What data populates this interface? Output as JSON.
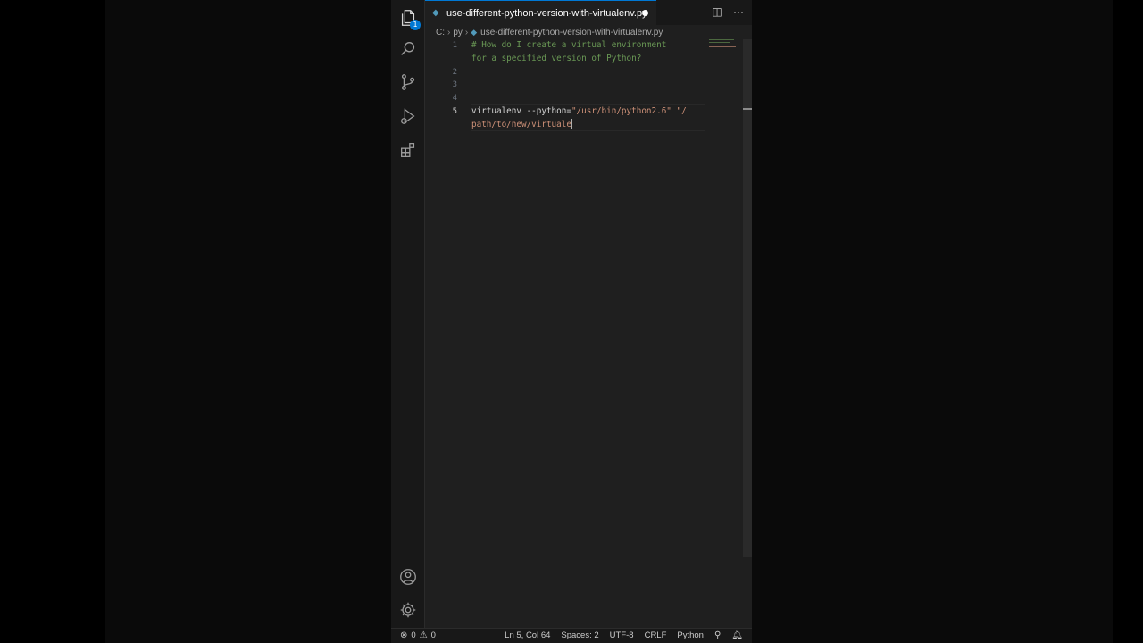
{
  "tab": {
    "label": "use-different-python-version-with-virtualenv.py"
  },
  "breadcrumb": {
    "drive": "C:",
    "folder": "py",
    "file": "use-different-python-version-with-virtualenv.py"
  },
  "editor": {
    "line_numbers": [
      "1",
      "2",
      "3",
      "4",
      "5"
    ],
    "comment_line_1": "# How do I create a virtual environment",
    "comment_line_2": "for a specified version of Python?",
    "code_cmd": "virtualenv --python=",
    "code_str1": "\"/usr/bin/python2.6\"",
    "code_str2_part1": "\"/",
    "code_str2_part2": "path/to/new/virtuale"
  },
  "activity": {
    "explorer_badge": "1"
  },
  "status": {
    "errors": "0",
    "warnings": "0",
    "position": "Ln 5, Col 64",
    "spaces": "Spaces: 2",
    "encoding": "UTF-8",
    "eol": "CRLF",
    "language": "Python"
  },
  "icons": [
    "files-icon",
    "search-icon",
    "source-control-icon",
    "run-debug-icon",
    "extensions-icon",
    "account-icon",
    "settings-gear-icon",
    "split-editor-icon",
    "more-actions-icon",
    "error-icon",
    "warning-icon",
    "copilot-icon",
    "bell-icon"
  ]
}
